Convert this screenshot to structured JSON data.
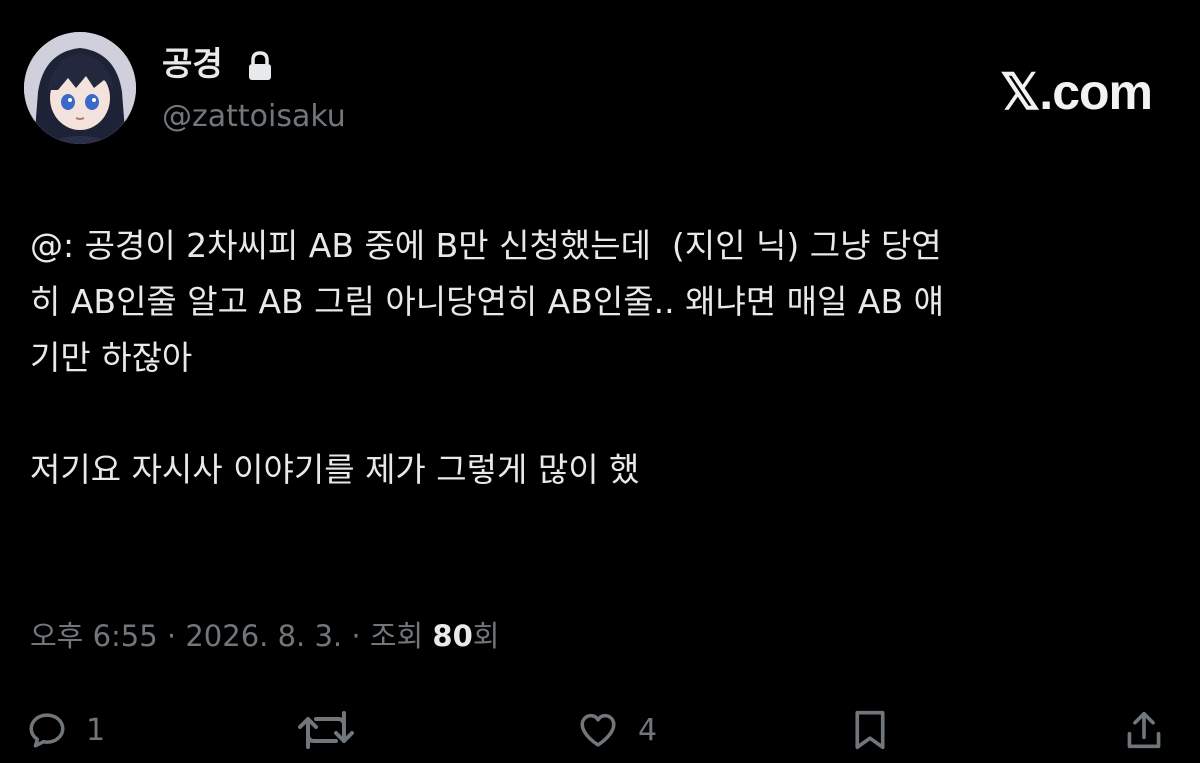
{
  "author": {
    "display_name": "공경",
    "handle": "@zattoisaku",
    "protected_icon": "lock-icon",
    "avatar_icon": "anime-avatar"
  },
  "brand": {
    "label": "𝕏.com"
  },
  "tweet": {
    "lines": [
      "@: 공경이 2차씨피 AB 중에 B만 신청했는데  (지인 닉) 그냥 당연",
      "히 AB인줄 알고 AB 그림 아니당연히 AB인줄.. 왜냐면 매일 AB 얘",
      "기만 하잖아",
      "저기요 자시사 이야기를 제가 그렇게 많이 했"
    ]
  },
  "meta": {
    "time": "오후 6:55",
    "sep1": " · ",
    "date": "2026. 8. 3.",
    "sep2": " · ",
    "views_label": "조회 ",
    "views_count": "80",
    "views_suffix": "회"
  },
  "actions": {
    "reply": {
      "icon": "reply-icon",
      "count": "1"
    },
    "retweet": {
      "icon": "retweet-icon",
      "count": ""
    },
    "like": {
      "icon": "heart-icon",
      "count": "4"
    },
    "bookmark": {
      "icon": "bookmark-icon"
    },
    "share": {
      "icon": "share-icon"
    }
  },
  "colors": {
    "background": "#000000",
    "text_primary": "#e7e9ea",
    "text_secondary": "#71767b"
  }
}
